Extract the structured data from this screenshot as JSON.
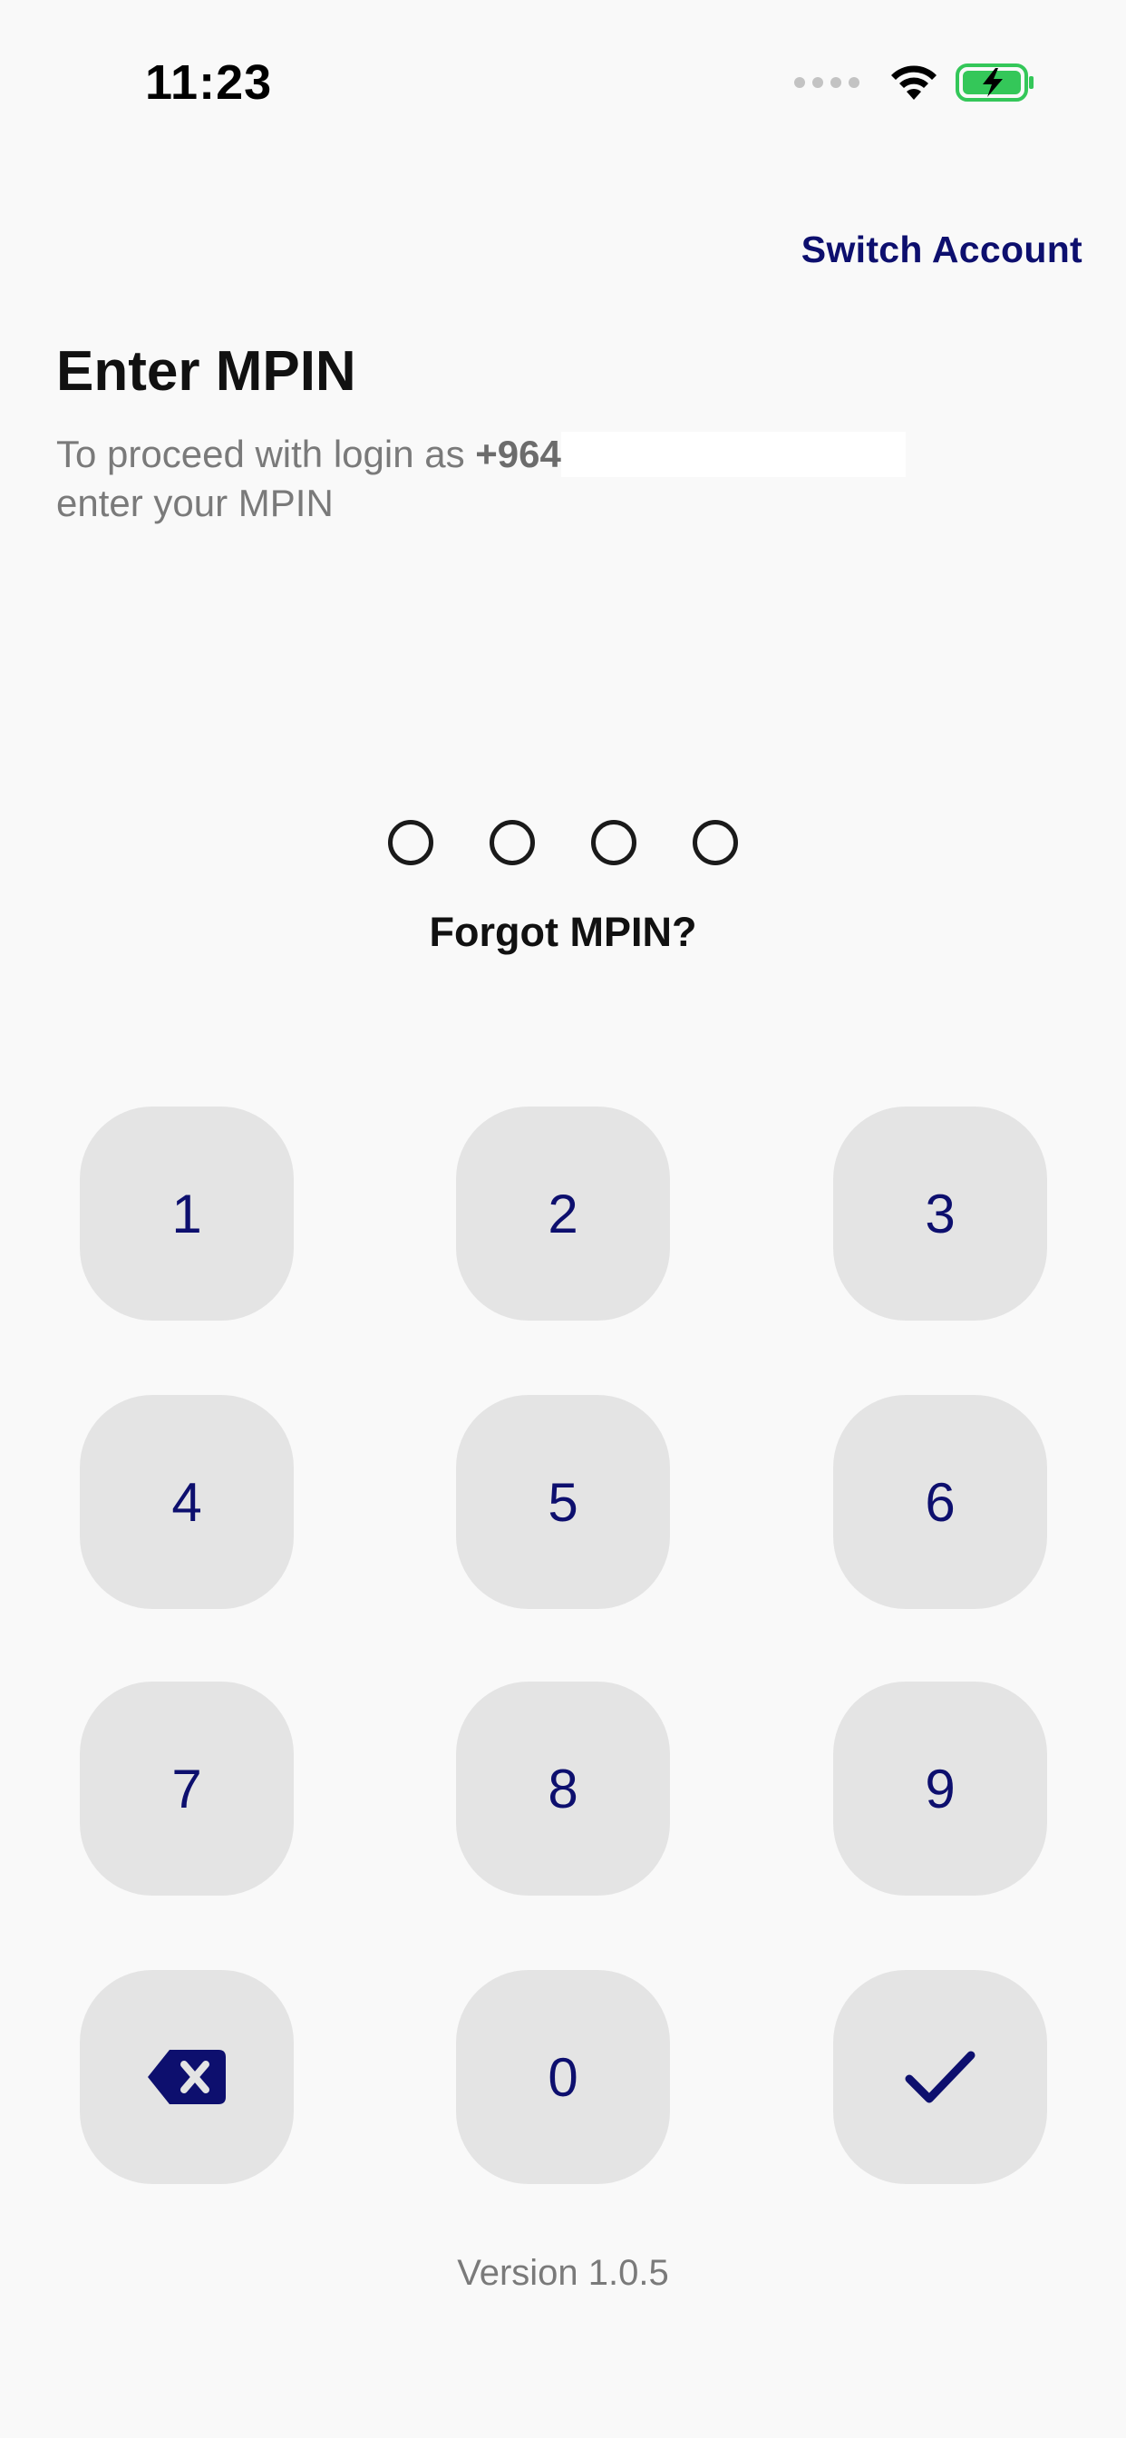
{
  "status_bar": {
    "time": "11:23",
    "icons": [
      "signal-dots-icon",
      "wifi-icon",
      "battery-charging-icon"
    ],
    "battery_color": "#34c759"
  },
  "header": {
    "switch_account_label": "Switch Account",
    "title": "Enter MPIN",
    "subtitle_prefix": "To proceed with login as ",
    "phone_prefix": "+964",
    "subtitle_suffix": "enter your MPIN"
  },
  "pin": {
    "length": 4,
    "entered": 0,
    "forgot_label": "Forgot MPIN?"
  },
  "keypad": {
    "keys": [
      "1",
      "2",
      "3",
      "4",
      "5",
      "6",
      "7",
      "8",
      "9",
      "0"
    ],
    "backspace_icon": "backspace-icon",
    "confirm_icon": "checkmark-icon"
  },
  "footer": {
    "version": "Version 1.0.5"
  },
  "colors": {
    "accent": "#0d0f6e",
    "background": "#f9f9f9",
    "key_background": "#e4e4e4"
  }
}
